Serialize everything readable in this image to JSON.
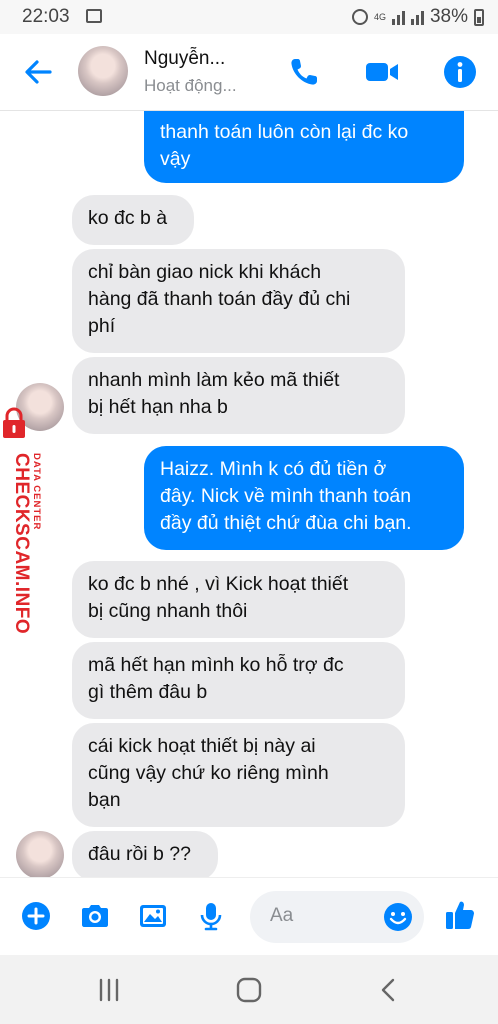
{
  "status_bar": {
    "time": "22:03",
    "network": "4G",
    "battery": "38%"
  },
  "header": {
    "contact_name": "Nguyễn...",
    "contact_status": "Hoạt động..."
  },
  "messages": [
    {
      "side": "out",
      "text": "thanh toán luôn còn lại đc ko\nvậy"
    },
    {
      "side": "in",
      "text": "ko đc b à"
    },
    {
      "side": "in",
      "text": "chỉ bàn giao nick khi khách\nhàng đã thanh toán đầy đủ chi\nphí"
    },
    {
      "side": "in",
      "text": "nhanh mình làm kẻo mã thiết\nbị hết hạn nha b"
    },
    {
      "side": "out",
      "text": "Haizz. Mình k có đủ tiền ở\nđây. Nick về mình thanh toán\nđầy đủ thiệt chứ đùa chi bạn."
    },
    {
      "side": "in",
      "text": "ko đc b nhé , vì Kick hoạt thiết\nbị cũng nhanh thôi"
    },
    {
      "side": "in",
      "text": "mã hết hạn mình ko hỗ trợ đc\ngì thêm đâu b"
    },
    {
      "side": "in",
      "text": "cái kick hoạt thiết bị này ai\ncũng vậy chứ ko riêng mình\nbạn"
    },
    {
      "side": "in",
      "text": "đâu rồi b ??"
    }
  ],
  "watermark": {
    "main": "CHECKSCAM.INFO",
    "sub": "DATA CENTER"
  },
  "composer": {
    "placeholder": "Aa"
  },
  "icons": {
    "back": "back-arrow-icon",
    "call": "phone-icon",
    "video": "video-camera-icon",
    "info": "info-icon",
    "more": "plus-circle-icon",
    "camera": "camera-icon",
    "gallery": "image-icon",
    "mic": "microphone-icon",
    "emoji": "emoji-icon",
    "like": "thumbs-up-icon"
  },
  "colors": {
    "brand_blue": "#0084ff",
    "incoming_bubble": "#e9e9eb",
    "watermark_red": "#e0262a"
  }
}
